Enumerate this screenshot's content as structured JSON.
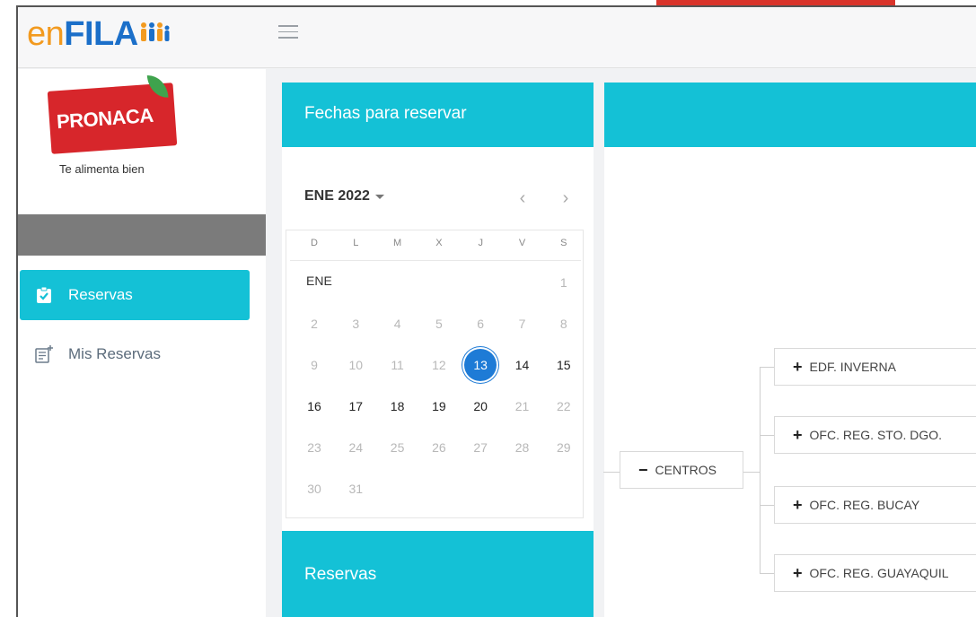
{
  "logo": {
    "part1": "en",
    "part2": "FILA"
  },
  "sidebar": {
    "brand": {
      "name": "PRONACA",
      "tagline": "Te alimenta bien"
    },
    "items": [
      {
        "label": "Reservas",
        "icon": "clipboard-check-icon",
        "active": true
      },
      {
        "label": "Mis Reservas",
        "icon": "list-add-icon",
        "active": false
      }
    ]
  },
  "calendar": {
    "title": "Fechas para reservar",
    "month_label": "ENE 2022",
    "month_short": "ENE",
    "weekdays": [
      "D",
      "L",
      "M",
      "X",
      "J",
      "V",
      "S"
    ],
    "weeks": [
      [
        null,
        null,
        null,
        null,
        null,
        null,
        {
          "d": "1",
          "s": "muted"
        }
      ],
      [
        {
          "d": "2",
          "s": "muted"
        },
        {
          "d": "3",
          "s": "muted"
        },
        {
          "d": "4",
          "s": "muted"
        },
        {
          "d": "5",
          "s": "muted"
        },
        {
          "d": "6",
          "s": "muted"
        },
        {
          "d": "7",
          "s": "muted"
        },
        {
          "d": "8",
          "s": "muted"
        }
      ],
      [
        {
          "d": "9",
          "s": "muted"
        },
        {
          "d": "10",
          "s": "muted"
        },
        {
          "d": "11",
          "s": "muted"
        },
        {
          "d": "12",
          "s": "muted"
        },
        {
          "d": "13",
          "s": "selected"
        },
        {
          "d": "14",
          "s": "avail"
        },
        {
          "d": "15",
          "s": "avail"
        }
      ],
      [
        {
          "d": "16",
          "s": "avail"
        },
        {
          "d": "17",
          "s": "avail"
        },
        {
          "d": "18",
          "s": "avail"
        },
        {
          "d": "19",
          "s": "avail"
        },
        {
          "d": "20",
          "s": "avail"
        },
        {
          "d": "21",
          "s": "muted"
        },
        {
          "d": "22",
          "s": "muted"
        }
      ],
      [
        {
          "d": "23",
          "s": "muted"
        },
        {
          "d": "24",
          "s": "muted"
        },
        {
          "d": "25",
          "s": "muted"
        },
        {
          "d": "26",
          "s": "muted"
        },
        {
          "d": "27",
          "s": "muted"
        },
        {
          "d": "28",
          "s": "muted"
        },
        {
          "d": "29",
          "s": "muted"
        }
      ],
      [
        {
          "d": "30",
          "s": "muted"
        },
        {
          "d": "31",
          "s": "muted"
        },
        null,
        null,
        null,
        null,
        null
      ]
    ]
  },
  "reservas_card": {
    "title": "Reservas"
  },
  "tree": {
    "root": {
      "label": "CENTROS",
      "symbol": "−"
    },
    "children": [
      {
        "label": "EDF. INVERNA",
        "symbol": "+"
      },
      {
        "label": "OFC. REG. STO. DGO.",
        "symbol": "+"
      },
      {
        "label": "OFC. REG. BUCAY",
        "symbol": "+"
      },
      {
        "label": "OFC. REG. GUAYAQUIL",
        "symbol": "+"
      }
    ]
  },
  "colors": {
    "accent": "#14c1d6",
    "selected_day": "#1e7bd6",
    "brand_red": "#d7262b",
    "logo_orange": "#f29a1f",
    "logo_blue": "#1b6fc9"
  }
}
